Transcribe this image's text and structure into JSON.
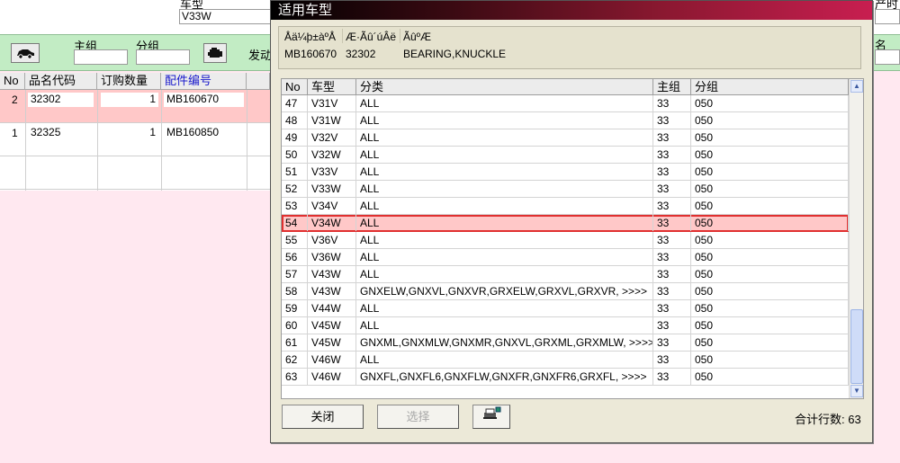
{
  "background": {
    "top_label_car_type": "车型",
    "top_field_car_type": "V33W",
    "top_label_right": "产时",
    "group_main_label": "主组",
    "group_sub_label": "分组",
    "engine_label": "发动",
    "right_label": "名",
    "table": {
      "headers": [
        "No",
        "品名代码",
        "订购数量",
        "配件编号"
      ],
      "rows": [
        {
          "no": "2",
          "code": "32302",
          "qty": "1",
          "part": "MB160670",
          "highlight": true
        },
        {
          "no": "1",
          "code": "32325",
          "qty": "1",
          "part": "MB160850",
          "highlight": false
        },
        {
          "no": "",
          "code": "",
          "qty": "",
          "part": "",
          "highlight": false
        }
      ]
    }
  },
  "dialog": {
    "title": "适用车型",
    "info_headers": [
      "Åä¼þ±àºÅ",
      "Æ·Ãû´úÂë",
      "ÃûºÆ"
    ],
    "info_values": [
      "MB160670",
      "32302",
      "BEARING,KNUCKLE"
    ],
    "grid_headers": [
      "No",
      "车型",
      "分类",
      "主组",
      "分组"
    ],
    "rows": [
      {
        "no": "47",
        "model": "V31V",
        "cls": "ALL",
        "main": "33",
        "sub": "050"
      },
      {
        "no": "48",
        "model": "V31W",
        "cls": "ALL",
        "main": "33",
        "sub": "050"
      },
      {
        "no": "49",
        "model": "V32V",
        "cls": "ALL",
        "main": "33",
        "sub": "050"
      },
      {
        "no": "50",
        "model": "V32W",
        "cls": "ALL",
        "main": "33",
        "sub": "050"
      },
      {
        "no": "51",
        "model": "V33V",
        "cls": "ALL",
        "main": "33",
        "sub": "050"
      },
      {
        "no": "52",
        "model": "V33W",
        "cls": "ALL",
        "main": "33",
        "sub": "050"
      },
      {
        "no": "53",
        "model": "V34V",
        "cls": "ALL",
        "main": "33",
        "sub": "050"
      },
      {
        "no": "54",
        "model": "V34W",
        "cls": "ALL",
        "main": "33",
        "sub": "050",
        "selected": true
      },
      {
        "no": "55",
        "model": "V36V",
        "cls": "ALL",
        "main": "33",
        "sub": "050"
      },
      {
        "no": "56",
        "model": "V36W",
        "cls": "ALL",
        "main": "33",
        "sub": "050"
      },
      {
        "no": "57",
        "model": "V43W",
        "cls": "ALL",
        "main": "33",
        "sub": "050"
      },
      {
        "no": "58",
        "model": "V43W",
        "cls": "GNXELW,GNXVL,GNXVR,GRXELW,GRXVL,GRXVR,  >>>>",
        "main": "33",
        "sub": "050"
      },
      {
        "no": "59",
        "model": "V44W",
        "cls": "ALL",
        "main": "33",
        "sub": "050"
      },
      {
        "no": "60",
        "model": "V45W",
        "cls": "ALL",
        "main": "33",
        "sub": "050"
      },
      {
        "no": "61",
        "model": "V45W",
        "cls": "GNXML,GNXMLW,GNXMR,GNXVL,GRXML,GRXMLW,  >>>>",
        "main": "33",
        "sub": "050"
      },
      {
        "no": "62",
        "model": "V46W",
        "cls": "ALL",
        "main": "33",
        "sub": "050"
      },
      {
        "no": "63",
        "model": "V46W",
        "cls": "GNXFL,GNXFL6,GNXFLW,GNXFR,GNXFR6,GRXFL,  >>>>",
        "main": "33",
        "sub": "050"
      }
    ],
    "close_label": "关闭",
    "select_label": "选择",
    "print_icon": "printer-icon",
    "total_label": "合计行数:",
    "total_value": "63"
  },
  "colors": {
    "selected_row_bg": "#ffc8c8",
    "selected_row_border": "#e03030",
    "green_bar": "#c2ecc4",
    "pink_bg": "#ffe8f0"
  }
}
